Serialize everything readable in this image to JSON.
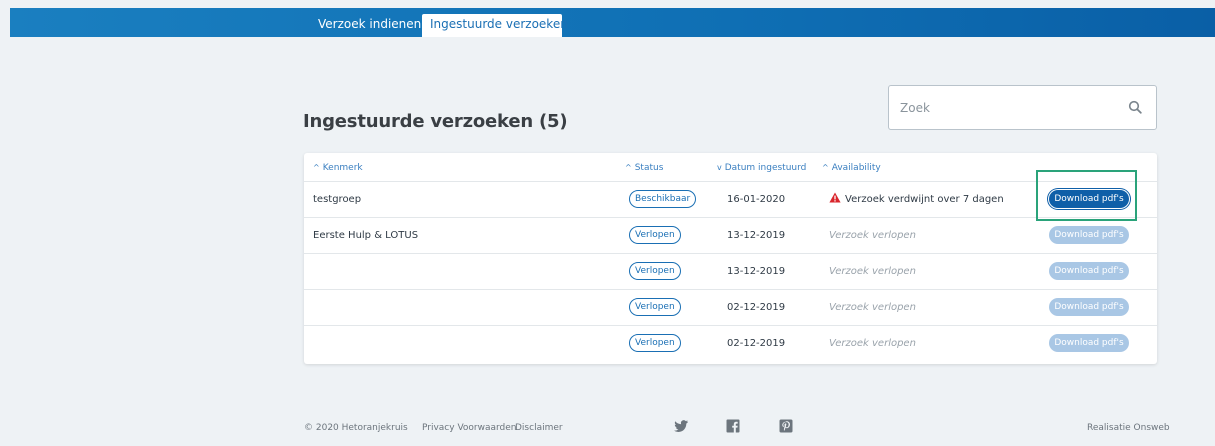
{
  "tabs": {
    "submit_label": "Verzoek indienen",
    "submitted_label": "Ingestuurde verzoeken"
  },
  "page": {
    "title": "Ingestuurde verzoeken (5)"
  },
  "search": {
    "value": "",
    "placeholder": "Zoek"
  },
  "table": {
    "columns": {
      "kenmerk": "Kenmerk",
      "status": "Status",
      "datum": "Datum ingestuurd",
      "availability": "Availability"
    },
    "sort_indicators": {
      "kenmerk": "up",
      "status": "up",
      "datum": "down",
      "availability": "up"
    },
    "rows": [
      {
        "kenmerk": "testgroep",
        "status": "Beschikbaar",
        "datum": "16-01-2020",
        "availability": "Verzoek verdwijnt over 7 dagen",
        "availability_warning": true,
        "download": "Download pdf's",
        "download_enabled": true
      },
      {
        "kenmerk": "Eerste Hulp & LOTUS",
        "status": "Verlopen",
        "datum": "13-12-2019",
        "availability": "Verzoek verlopen",
        "availability_warning": false,
        "download": "Download pdf's",
        "download_enabled": false
      },
      {
        "kenmerk": "",
        "status": "Verlopen",
        "datum": "13-12-2019",
        "availability": "Verzoek verlopen",
        "availability_warning": false,
        "download": "Download pdf's",
        "download_enabled": false
      },
      {
        "kenmerk": "",
        "status": "Verlopen",
        "datum": "02-12-2019",
        "availability": "Verzoek verlopen",
        "availability_warning": false,
        "download": "Download pdf's",
        "download_enabled": false
      },
      {
        "kenmerk": "",
        "status": "Verlopen",
        "datum": "02-12-2019",
        "availability": "Verzoek verlopen",
        "availability_warning": false,
        "download": "Download pdf's",
        "download_enabled": false
      }
    ]
  },
  "footer": {
    "copyright": "© 2020 Hetoranjekruis",
    "privacy": "Privacy Voorwaarden",
    "disclaimer": "Disclaimer",
    "credit": "Realisatie Onsweb",
    "social_icons": [
      "twitter-icon",
      "facebook-icon",
      "pinterest-icon"
    ]
  },
  "colors": {
    "brand_blue": "#0f5fa8",
    "tab_bar": "#1a7fc0",
    "warning_red": "#d9262c",
    "focus_green": "#2aa37a",
    "disabled_button": "#a9c7e5"
  }
}
